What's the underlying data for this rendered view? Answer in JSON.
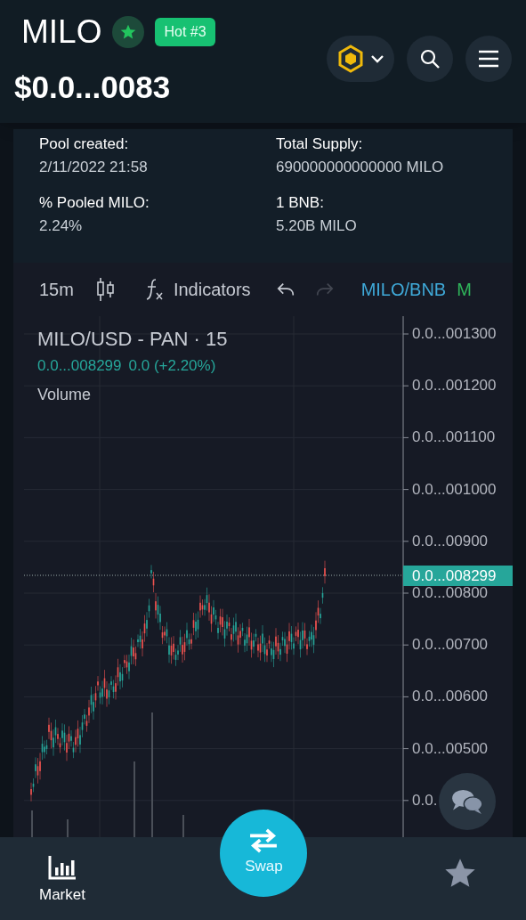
{
  "header": {
    "symbol": "MILO",
    "favorite": true,
    "badge": "Hot #3",
    "price": "$0.0...0083"
  },
  "info": [
    {
      "label": "Pool created:",
      "value": "2/11/2022 21:58"
    },
    {
      "label": "Total Supply:",
      "value": "690000000000000 MILO"
    },
    {
      "label": "% Pooled MILO:",
      "value": "2.24%"
    },
    {
      "label": "1 BNB:",
      "value": "5.20B MILO"
    }
  ],
  "toolbar": {
    "interval": "15m",
    "indicators": "Indicators",
    "redo_disabled": true,
    "pairs": [
      {
        "label": "MILO/BNB",
        "color": "#3fa9d8"
      },
      {
        "label": "M",
        "color": "#2fb35a"
      }
    ]
  },
  "chart": {
    "title": "MILO/USD - PAN · 15",
    "last": "0.0...008299",
    "change": "0.0 (+2.20%)",
    "volume_label": "Volume",
    "price_labels": [
      "0.0...001300",
      "0.0...001200",
      "0.0...001100",
      "0.0...001000",
      "0.0...00900",
      "0.0...00800",
      "0.0...00700",
      "0.0...00600",
      "0.0...00500",
      "0.0."
    ],
    "current_price": "0.0...008299"
  },
  "nav": [
    {
      "kind": "market",
      "label": "Market"
    },
    {
      "kind": "swap",
      "label": "Swap"
    },
    {
      "kind": "favorites"
    }
  ]
}
